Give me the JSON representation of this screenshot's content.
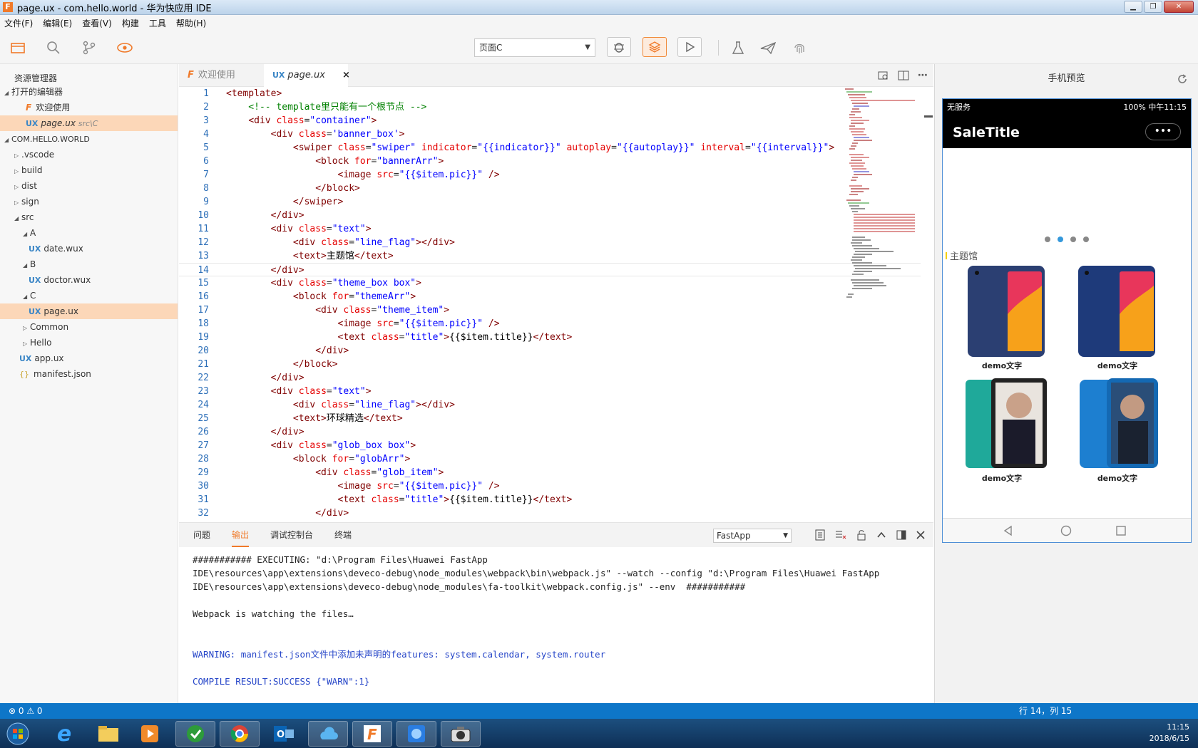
{
  "window": {
    "title": "page.ux - com.hello.world - 华为快应用 IDE"
  },
  "menu": [
    "文件(F)",
    "编辑(E)",
    "查看(V)",
    "构建",
    "工具",
    "帮助(H)"
  ],
  "toolbar": {
    "page_select": "页面C"
  },
  "sidebar": {
    "header": "资源管理器",
    "open_editors_label": "打开的编辑器",
    "open_editors": [
      {
        "name": "欢迎使用",
        "path": ""
      },
      {
        "name": "page.ux",
        "path": "src\\C"
      }
    ],
    "project_label": "COM.HELLO.WORLD",
    "tree": [
      ".vscode",
      "build",
      "dist",
      "sign",
      "src",
      "A",
      "date.wux",
      "B",
      "doctor.wux",
      "C",
      "page.ux",
      "Common",
      "Hello",
      "app.ux",
      "manifest.json"
    ]
  },
  "tabs": [
    {
      "label": "欢迎使用"
    },
    {
      "label": "page.ux",
      "close": "×"
    }
  ],
  "code": [
    "1",
    "2",
    "3",
    "4",
    "5",
    "6",
    "7",
    "8",
    "9",
    "10",
    "11",
    "12",
    "13",
    "14",
    "15",
    "16",
    "17",
    "18",
    "19",
    "20",
    "21",
    "22",
    "23",
    "24",
    "25",
    "26",
    "27",
    "28",
    "29",
    "30",
    "31",
    "32"
  ],
  "panel": {
    "tabs": [
      "问题",
      "输出",
      "调试控制台",
      "终端"
    ],
    "active_tab": "输出",
    "output_select": "FastApp",
    "lines": [
      "########### EXECUTING: \"d:\\Program Files\\Huawei FastApp",
      "IDE\\resources\\app\\extensions\\deveco-debug\\node_modules\\webpack\\bin\\webpack.js\" --watch --config \"d:\\Program Files\\Huawei FastApp",
      "IDE\\resources\\app\\extensions\\deveco-debug\\node_modules\\fa-toolkit\\webpack.config.js\" --env  ###########",
      "Webpack is watching the files…",
      "WARNING: manifest.json文件中添加未声明的features: system.calendar, system.router",
      "COMPILE RESULT:SUCCESS {\"WARN\":1}"
    ]
  },
  "preview": {
    "title": "手机预览",
    "status_left": "无服务",
    "status_right": "100%  中午11:15",
    "app_title": "SaleTitle",
    "more": "•••",
    "section": "主题馆",
    "products": [
      "demo文字",
      "demo文字",
      "demo文字",
      "demo文字"
    ]
  },
  "status": {
    "problems": "⊗ 0 ⚠ 0",
    "position": "行 14，列 15"
  },
  "tray": {
    "time": "11:15",
    "date": "2018/6/15"
  },
  "colors": {
    "accent": "#f07a2a",
    "status": "#0e76c8"
  }
}
